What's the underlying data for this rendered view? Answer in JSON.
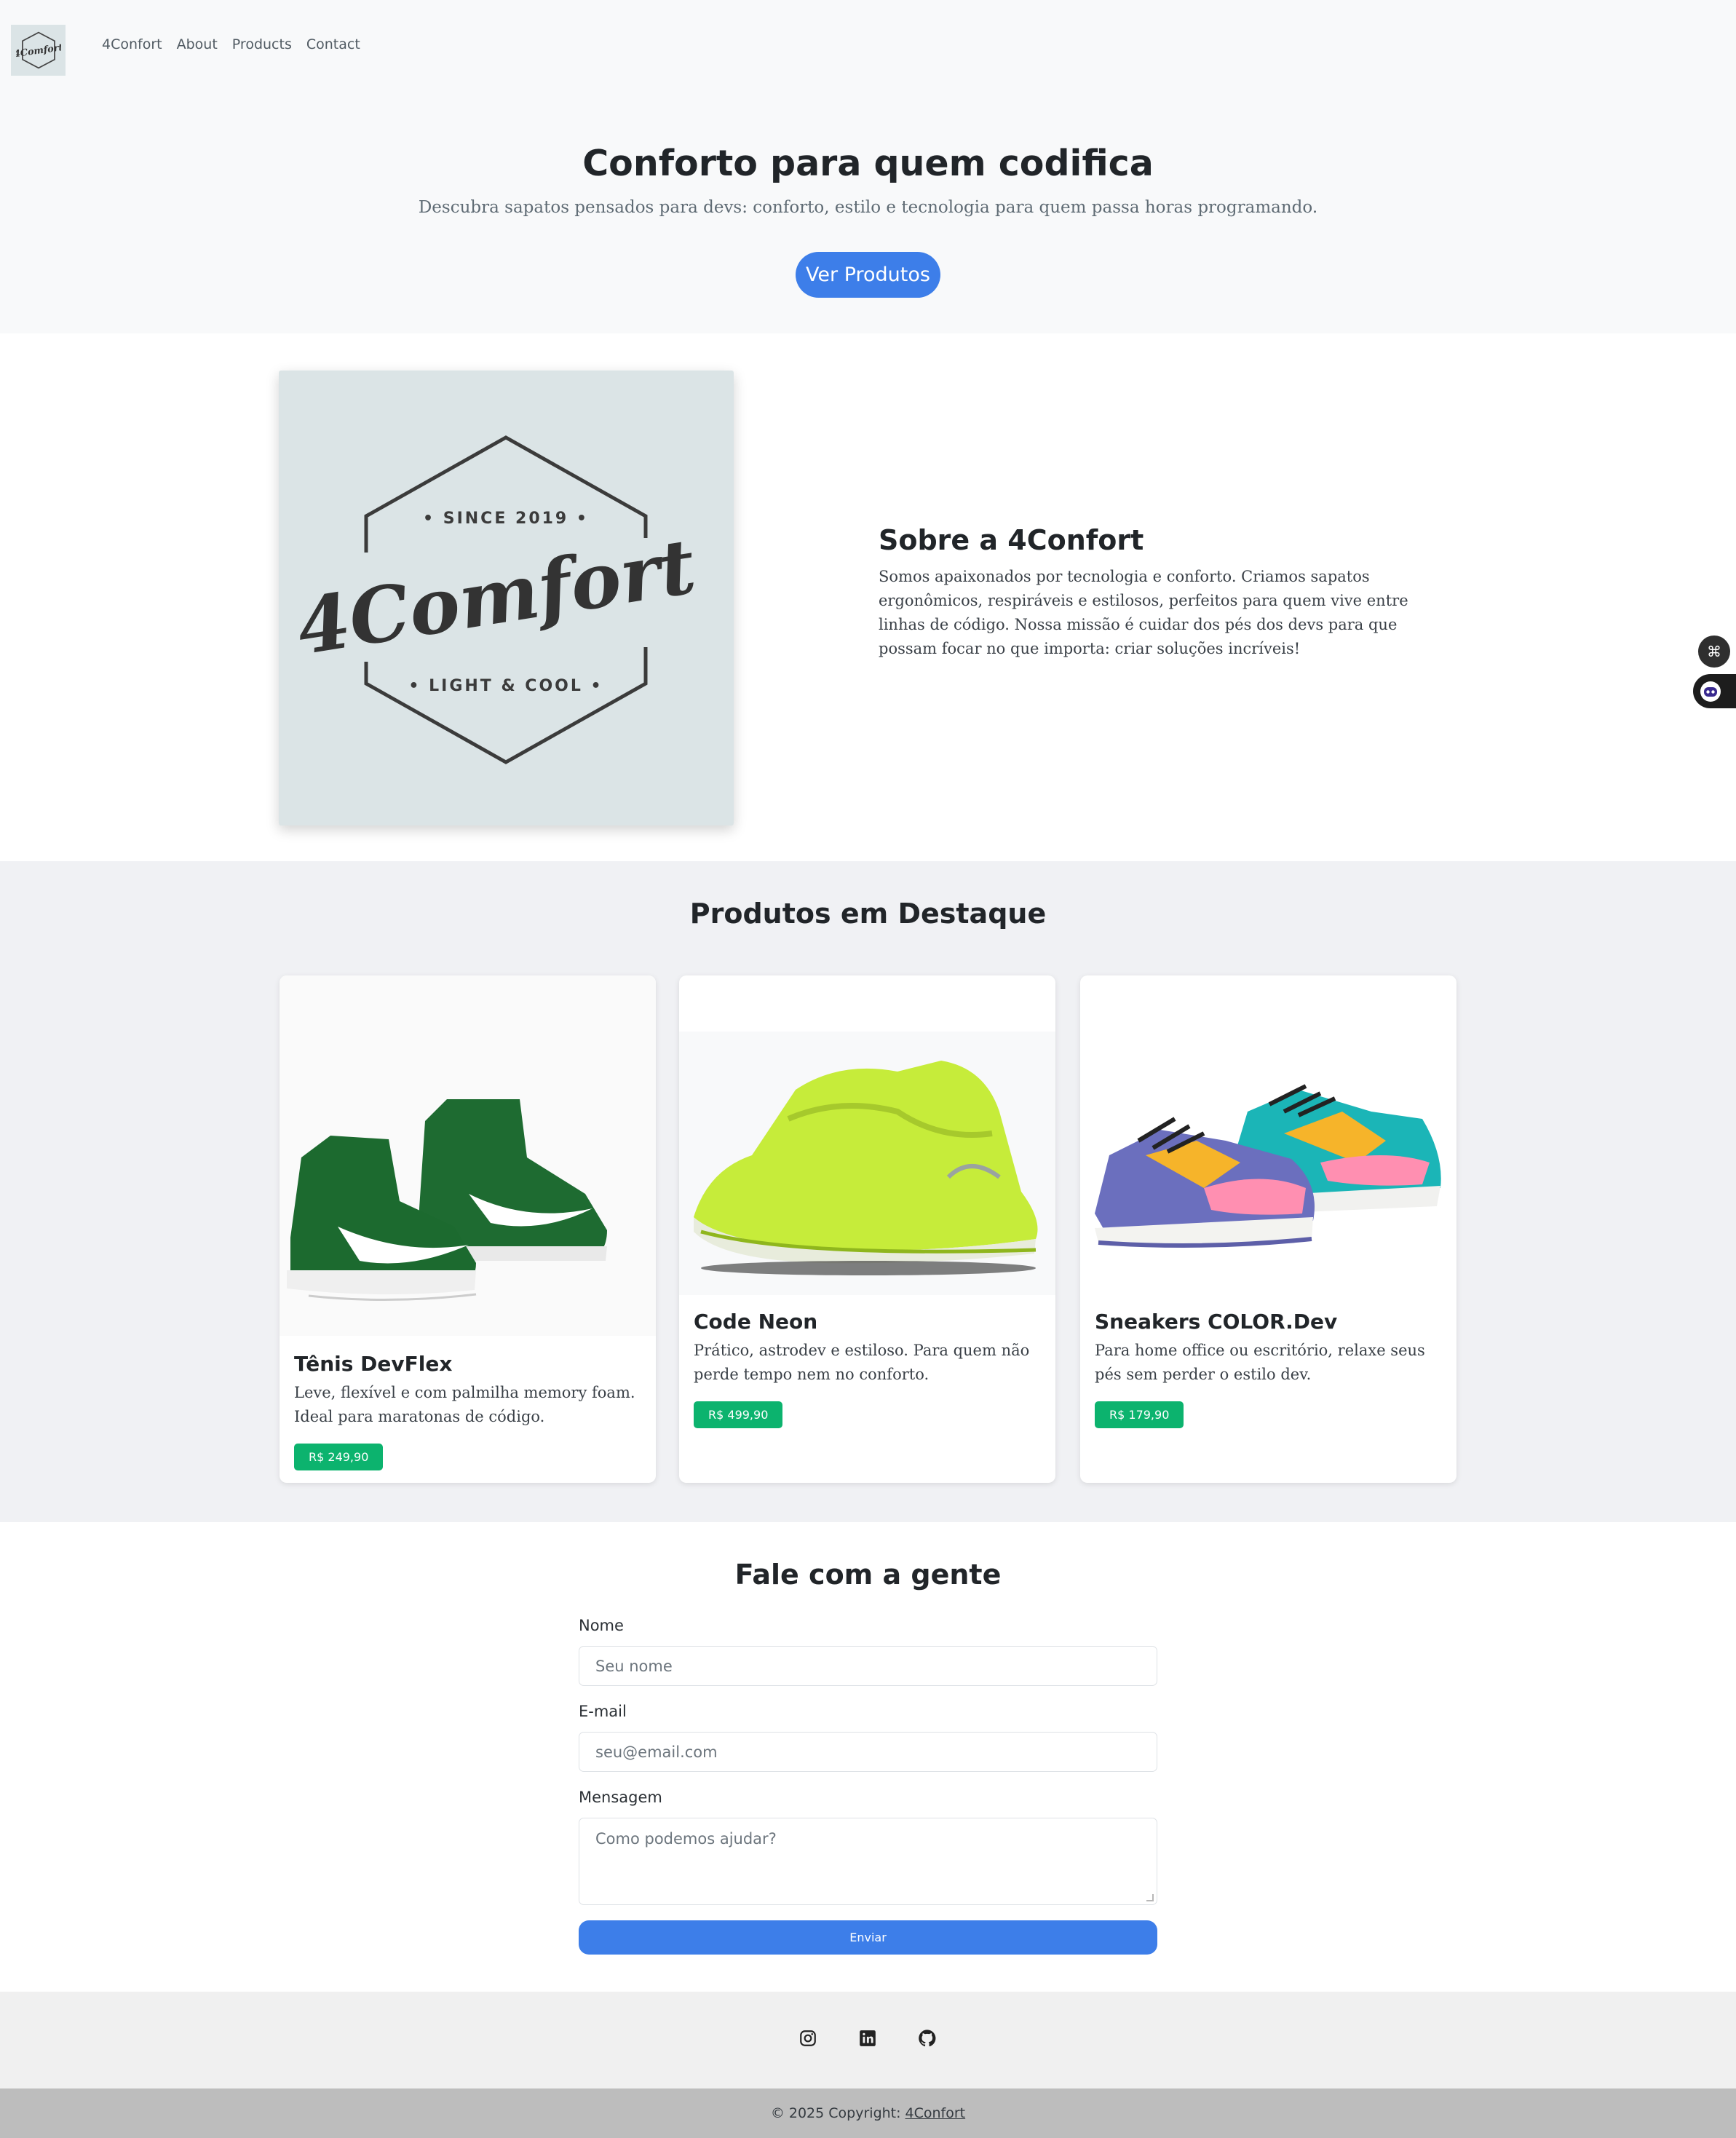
{
  "nav": {
    "brand": "4Confort",
    "links": [
      "4Confort",
      "About",
      "Products",
      "Contact"
    ]
  },
  "hero": {
    "title": "Conforto para quem codifica",
    "subtitle": "Descubra sapatos pensados para devs: conforto, estilo e tecnologia para quem passa horas programando.",
    "button": "Ver Produtos"
  },
  "logo": {
    "top_text": "• SINCE 2019 •",
    "brand": "4Comfort",
    "bottom_text": "• LIGHT & COOL •"
  },
  "about": {
    "title": "Sobre a 4Confort",
    "text": "Somos apaixonados por tecnologia e conforto. Criamos sapatos ergonômicos, respiráveis e estilosos, perfeitos para quem vive entre linhas de código. Nossa missão é cuidar dos pés dos devs para que possam focar no que importa: criar soluções incríveis!"
  },
  "products": {
    "title": "Produtos em Destaque",
    "items": [
      {
        "name": "Tênis DevFlex",
        "desc": "Leve, flexível e com palmilha memory foam. Ideal para maratonas de código.",
        "price": "R$ 249,90",
        "image": "green-high-top-sneaker"
      },
      {
        "name": "Code Neon",
        "desc": "Prático, astrodev e estiloso. Para quem não perde tempo nem no conforto.",
        "price": "R$ 499,90",
        "image": "neon-yellow-sneaker"
      },
      {
        "name": "Sneakers COLOR.Dev",
        "desc": "Para home office ou escritório, relaxe seus pés sem perder o estilo dev.",
        "price": "R$ 179,90",
        "image": "colorful-sneaker"
      }
    ]
  },
  "contact": {
    "title": "Fale com a gente",
    "name_label": "Nome",
    "name_placeholder": "Seu nome",
    "email_label": "E-mail",
    "email_placeholder": "seu@email.com",
    "message_label": "Mensagem",
    "message_placeholder": "Como podemos ajudar?",
    "submit": "Enviar"
  },
  "footer": {
    "social_icons": [
      "instagram-icon",
      "linkedin-icon",
      "github-icon"
    ],
    "copyright_prefix": "© 2025 Copyright:",
    "copyright_link": "4Confort"
  },
  "colors": {
    "primary": "#3d7ee9",
    "price_badge": "#0cb36e",
    "hero_bg": "#f8f9fa",
    "section_bg": "#f0f1f4",
    "logo_bg": "#dbe4e6"
  }
}
